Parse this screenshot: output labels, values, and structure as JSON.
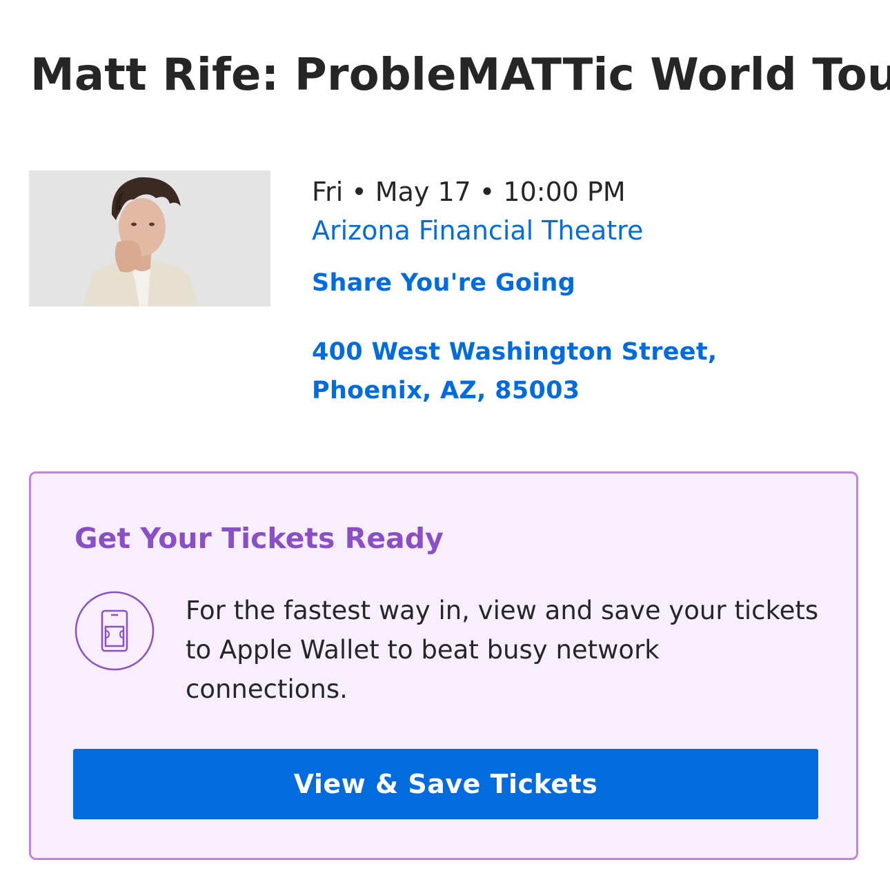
{
  "event": {
    "title": "Matt Rife: ProbleMATTic World Tour",
    "datetime": "Fri • May 17 • 10:00 PM",
    "venue": "Arizona Financial Theatre",
    "share_label": "Share You're Going",
    "address": "400 West Washington Street, Phoenix, AZ, 85003",
    "image_icon": "event-photo"
  },
  "tickets_card": {
    "heading": "Get Your Tickets Ready",
    "icon": "phone-ticket-icon",
    "message": "For the fastest way in, view and save your tickets to Apple Wallet to beat busy network connections.",
    "button_label": "View & Save Tickets"
  },
  "colors": {
    "link_blue": "#026cdf",
    "card_border": "#c580e6",
    "card_background": "#f7efff",
    "heading_purple": "#8a4fc7",
    "button_blue": "#026cdf"
  }
}
